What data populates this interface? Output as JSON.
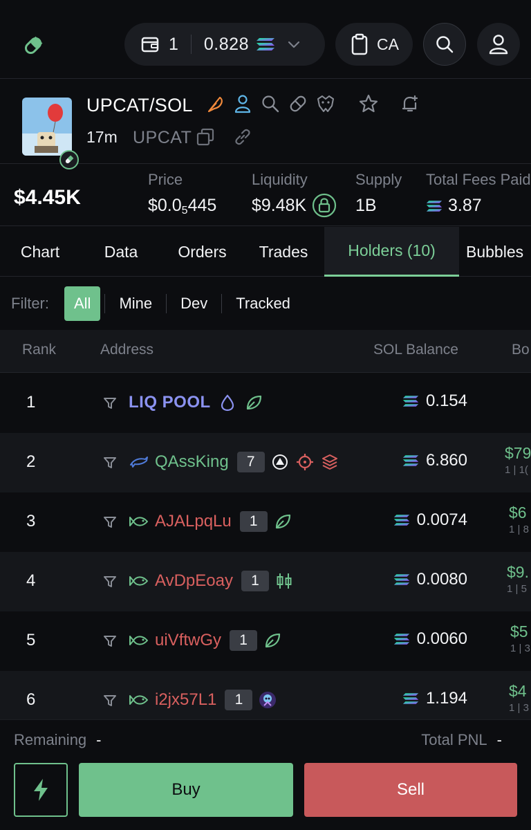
{
  "topbar": {
    "wallet_count": "1",
    "wallet_balance": "0.828",
    "ca_label": "CA"
  },
  "token": {
    "pair": "UPCAT/SOL",
    "age": "17m",
    "ticker": "UPCAT"
  },
  "stats": {
    "market_cap": "$4.45K",
    "price_label": "Price",
    "price_prefix": "$0.0",
    "price_sub": "5",
    "price_suffix": "445",
    "liquidity_label": "Liquidity",
    "liquidity_value": "$9.48K",
    "supply_label": "Supply",
    "supply_value": "1B",
    "fees_label": "Total Fees Paid",
    "fees_value": "3.87"
  },
  "tabs": [
    {
      "label": "Chart"
    },
    {
      "label": "Data"
    },
    {
      "label": "Orders"
    },
    {
      "label": "Trades"
    },
    {
      "label": "Holders",
      "count": "(10)"
    },
    {
      "label": "Bubbles"
    }
  ],
  "filter": {
    "label": "Filter:",
    "options": [
      "All",
      "Mine",
      "Dev",
      "Tracked"
    ]
  },
  "table": {
    "headers": {
      "rank": "Rank",
      "address": "Address",
      "sol_balance": "SOL Balance",
      "bought": "Bo"
    },
    "rows": [
      {
        "rank": "1",
        "address": "LIQ POOL",
        "sol": "0.154",
        "bought": "",
        "bought_sub": ""
      },
      {
        "rank": "2",
        "address": "QAssKing",
        "badge": "7",
        "sol": "6.860",
        "bought": "$79",
        "bought_sub": "1 | 1("
      },
      {
        "rank": "3",
        "address": "AJALpqLu",
        "badge": "1",
        "sol": "0.0074",
        "bought": "$6",
        "bought_sub": "1 | 8"
      },
      {
        "rank": "4",
        "address": "AvDpEoay",
        "badge": "1",
        "sol": "0.0080",
        "bought": "$9.",
        "bought_sub": "1 | 5"
      },
      {
        "rank": "5",
        "address": "uiVftwGy",
        "badge": "1",
        "sol": "0.0060",
        "bought": "$5",
        "bought_sub": "1 | 3"
      },
      {
        "rank": "6",
        "address": "i2jx57L1",
        "badge": "1",
        "sol": "1.194",
        "bought": "$4",
        "bought_sub": "1 | 3"
      }
    ]
  },
  "bottom": {
    "remaining_label": "Remaining",
    "remaining_value": "-",
    "pnl_label": "Total PNL",
    "pnl_value": "-",
    "buy_label": "Buy",
    "sell_label": "Sell"
  },
  "colors": {
    "accent_green": "#6fc18c",
    "sell_red": "#c8595b",
    "pool_purple": "#8b92f0",
    "address_red": "#d9605f",
    "background": "#0c0d10"
  }
}
